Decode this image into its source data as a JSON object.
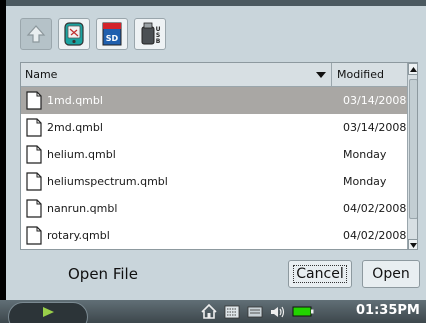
{
  "toolbar": {
    "buttons": [
      {
        "name": "up-folder-button",
        "icon": "up-arrow-icon"
      },
      {
        "name": "pda-storage-button",
        "icon": "pda-device-icon"
      },
      {
        "name": "sd-card-button",
        "icon": "sd-card-icon",
        "badge": "SD"
      },
      {
        "name": "usb-drive-button",
        "icon": "usb-drive-icon",
        "badge": "USB"
      }
    ]
  },
  "list": {
    "columns": {
      "name": "Name",
      "modified": "Modified"
    },
    "sort_indicator": "sort-descending-icon",
    "rows": [
      {
        "name": "1md.qmbl",
        "modified": "03/14/2008",
        "selected": true
      },
      {
        "name": "2md.qmbl",
        "modified": "03/14/2008",
        "selected": false
      },
      {
        "name": "helium.qmbl",
        "modified": "Monday",
        "selected": false
      },
      {
        "name": "heliumspectrum.qmbl",
        "modified": "Monday",
        "selected": false
      },
      {
        "name": "nanrun.qmbl",
        "modified": "04/02/2008",
        "selected": false
      },
      {
        "name": "rotary.qmbl",
        "modified": "04/02/2008",
        "selected": false
      }
    ]
  },
  "dialog": {
    "title": "Open File",
    "cancel_label": "Cancel",
    "open_label": "Open"
  },
  "taskbar": {
    "clock": "01:35PM",
    "tray_icons": [
      "home-icon",
      "keyboard-icon",
      "window-list-icon",
      "volume-icon",
      "battery-icon"
    ]
  },
  "colors": {
    "dialog_bg": "#c9d5db",
    "selected_row": "#a9a7a4",
    "taskbar": "#4b5960",
    "battery_green": "#22d400"
  }
}
